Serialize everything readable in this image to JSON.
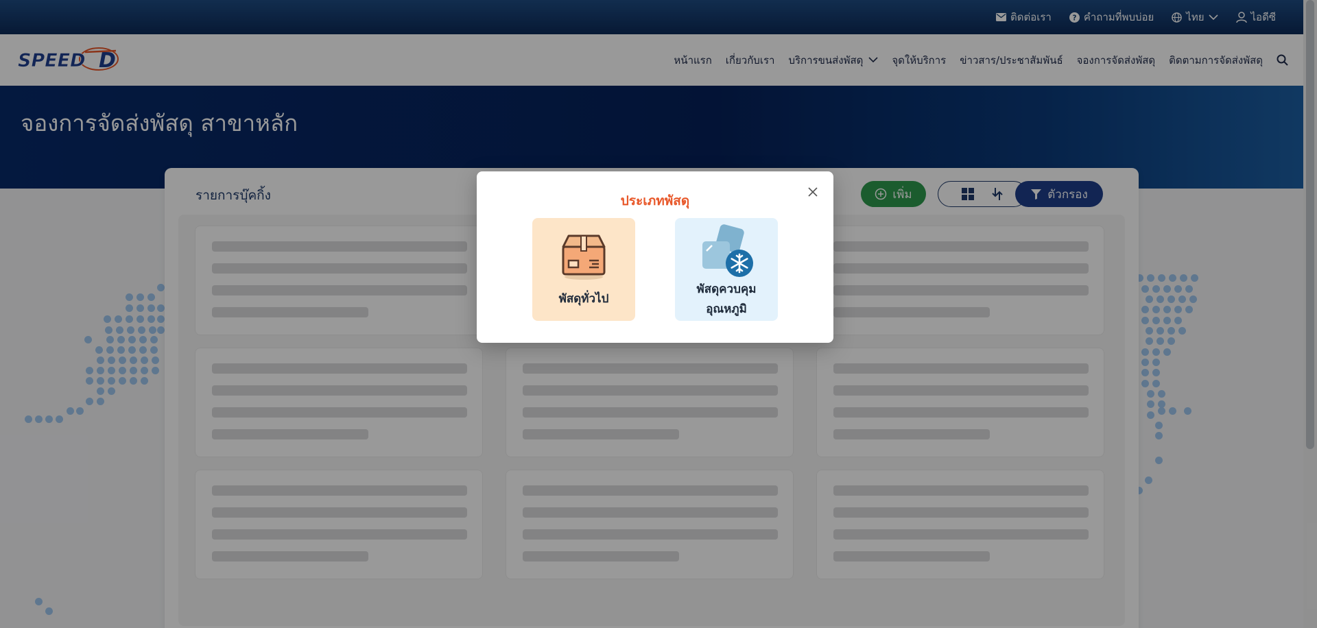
{
  "topbar": {
    "contact": "ติดต่อเรา",
    "faq": "คำถามที่พบบ่อย",
    "language": "ไทย",
    "account": "ไอดีซี"
  },
  "brand": {
    "logo_text": "SPEED-D"
  },
  "nav": {
    "items": [
      "หน้าแรก",
      "เกี่ยวกับเรา",
      "บริการขนส่งพัสดุ",
      "จุดให้บริการ",
      "ข่าวสาร/ประชาสัมพันธ์",
      "จองการจัดส่งพัสดุ",
      "ติดตามการจัดส่งพัสดุ"
    ]
  },
  "hero": {
    "title": "จองการจัดส่งพัสดุ สาขาหลัก"
  },
  "bookings": {
    "title": "รายการบุ๊คกิ้ง",
    "add_label": "เพิ่ม",
    "filter_label": "ตัวกรอง"
  },
  "modal": {
    "title": "ประเภทพัสดุ",
    "options": {
      "general": "พัสดุทั่วไป",
      "cold_line1": "พัสดุควบคุม",
      "cold_line2": "อุณหภูมิ"
    }
  },
  "colors": {
    "topbar": "#1e4c83",
    "hero": "#06215a",
    "accent": "#e8582a",
    "add_button": "#2e9a4d",
    "filter_button": "#1e3f8a"
  },
  "icons": [
    "mail-icon",
    "question-icon",
    "globe-icon",
    "user-icon",
    "chevron-down-icon",
    "search-icon",
    "plus-circle-icon",
    "grid-icon",
    "sort-icon",
    "filter-icon",
    "close-icon",
    "box-icon",
    "cold-box-icon"
  ]
}
